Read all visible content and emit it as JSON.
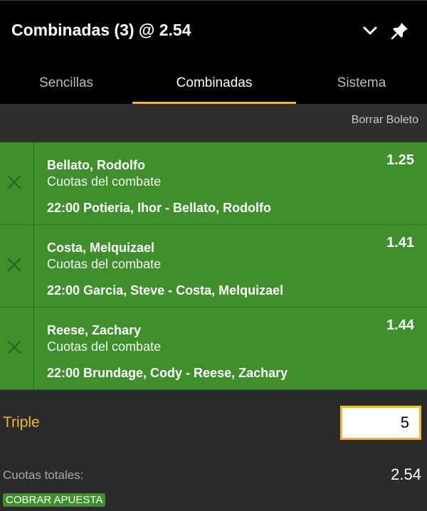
{
  "header": {
    "title": "Combinadas (3) @ 2.54",
    "collapse_icon": "chevron-down-icon",
    "pin_icon": "pin-icon"
  },
  "tabs": [
    {
      "label": "Sencillas",
      "active": false
    },
    {
      "label": "Combinadas",
      "active": true
    },
    {
      "label": "Sistema",
      "active": false
    }
  ],
  "toolbar": {
    "clear_label": "Borrar Boleto"
  },
  "selections": [
    {
      "name": "Bellato, Rodolfo",
      "market": "Cuotas del combate",
      "event": "22:00 Potieria, Ihor - Bellato, Rodolfo",
      "odds": "1.25"
    },
    {
      "name": "Costa, Melquizael",
      "market": "Cuotas del combate",
      "event": "22:00 Garcia, Steve - Costa, Melquizael",
      "odds": "1.41"
    },
    {
      "name": "Reese, Zachary",
      "market": "Cuotas del combate",
      "event": "22:00 Brundage, Cody - Reese, Zachary",
      "odds": "1.44"
    }
  ],
  "stake": {
    "label": "Triple",
    "value": "5",
    "total_label": "Cuotas totales:",
    "total_value": "2.54",
    "cashout_label": "COBRAR APUESTA"
  },
  "colors": {
    "accent": "#f2b62e",
    "selection_bg": "#3f8f2d",
    "header_bg": "#000000",
    "panel_bg": "#2b2b2b"
  }
}
